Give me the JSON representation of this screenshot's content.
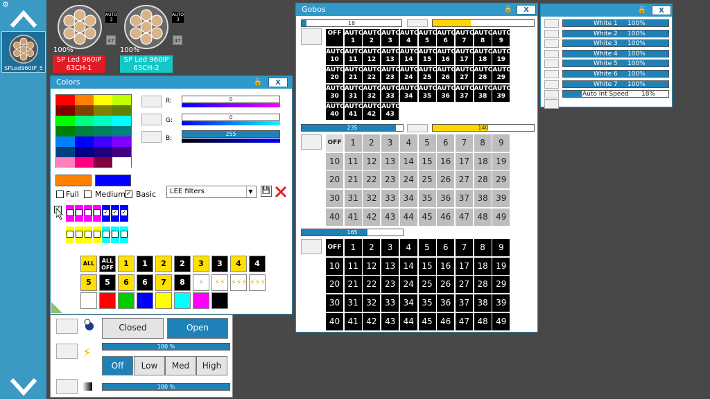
{
  "sidebar": {
    "selected_fixture_label": "SPLed960IP_5"
  },
  "fixtures": [
    {
      "percent": "100%",
      "auto_line1": "AUTO",
      "auto_line2": "3",
      "channel": "47",
      "name": "SP Led 960IP",
      "mode": "63CH-1",
      "color": "#e01b24"
    },
    {
      "percent": "100%",
      "auto_line1": "AUTO",
      "auto_line2": "3",
      "channel": "47",
      "name": "SP Led 960IP",
      "mode": "63CH-2",
      "color": "#16c7c7"
    }
  ],
  "colors_window": {
    "title": "Colors",
    "palette": [
      [
        "#ff0000",
        "#ff8000",
        "#ffff00",
        "#c0ff00"
      ],
      [
        "#800000",
        "#804000",
        "#808000",
        "#608000"
      ],
      [
        "#00ff00",
        "#00ff80",
        "#00ffc0",
        "#00ffff"
      ],
      [
        "#008000",
        "#008040",
        "#008060",
        "#008080"
      ],
      [
        "#0080ff",
        "#0000ff",
        "#4000ff",
        "#8000ff"
      ],
      [
        "#004080",
        "#000080",
        "#200080",
        "#400080"
      ],
      [
        "#ff80c0",
        "#ff0080",
        "#800040",
        "#ffffff"
      ]
    ],
    "r_label": "R:",
    "r_value": "0",
    "g_label": "G:",
    "g_value": "0",
    "b_label": "B:",
    "b_value": "255",
    "swatch_current": "#ff8000",
    "swatch_target": "#0000ff",
    "opt_full": "Full",
    "opt_medium": "Medium",
    "opt_basic": "Basic",
    "filter_select": "LEE filters",
    "save_icon": "save-icon",
    "delete_icon": "close-icon",
    "grid_keys": [
      [
        {
          "t": "ALL",
          "c": "y"
        },
        {
          "t": "ALL OFF",
          "c": "k"
        },
        {
          "t": "1",
          "c": "y"
        },
        {
          "t": "1",
          "c": "k"
        },
        {
          "t": "2",
          "c": "y"
        },
        {
          "t": "2",
          "c": "k"
        },
        {
          "t": "3",
          "c": "y"
        },
        {
          "t": "3",
          "c": "k"
        },
        {
          "t": "4",
          "c": "y"
        },
        {
          "t": "4",
          "c": "k"
        }
      ],
      [
        {
          "t": "5",
          "c": "y"
        },
        {
          "t": "5",
          "c": "k"
        },
        {
          "t": "6",
          "c": "y"
        },
        {
          "t": "6",
          "c": "k"
        },
        {
          "t": "7",
          "c": "y"
        },
        {
          "t": "8",
          "c": "k"
        },
        {
          "t": "⚡",
          "c": "w"
        },
        {
          "t": "⚡⚡",
          "c": "w"
        },
        {
          "t": "⚡⚡⚡",
          "c": "w"
        },
        {
          "t": "⚡⚡⚡",
          "c": "w"
        }
      ]
    ],
    "color_keys": [
      "#ffffff",
      "#ff0000",
      "#00cc00",
      "#0000ff",
      "#ffff00",
      "#00ffff",
      "#ff00ff",
      "#000000"
    ]
  },
  "shutter_panel": {
    "closed_label": "Closed",
    "open_label": "Open",
    "dimmer_text": "100 %",
    "dimmer_fraction": 1.0,
    "strobe_off": "Off",
    "strobe_low": "Low",
    "strobe_med": "Med",
    "strobe_high": "High",
    "zoom_text": "100 %",
    "zoom_fraction": 1.0
  },
  "gobos_window": {
    "title": "Gobos",
    "slider1_value": "18",
    "slider1_fraction": 0.05,
    "slider1b_fraction": 0.38,
    "auto_off": "OFF",
    "auto_prefix": "AUTO",
    "slider2_value": "235",
    "slider2_fraction": 0.93,
    "slider2b_value": "140",
    "slider2b_fraction": 0.55,
    "gobo_off": "OFF",
    "slider3_value": "165",
    "slider3_fraction": 0.65,
    "gobo2_off": "OFF"
  },
  "whites_window": {
    "rows": [
      {
        "name": "White 1",
        "value": "100%"
      },
      {
        "name": "White 2",
        "value": "100%"
      },
      {
        "name": "White 3",
        "value": "100%"
      },
      {
        "name": "White 4",
        "value": "100%"
      },
      {
        "name": "White 5",
        "value": "100%"
      },
      {
        "name": "White 6",
        "value": "100%"
      },
      {
        "name": "White 7",
        "value": "100%"
      }
    ],
    "speed_label": "Auto Int Speed",
    "speed_value": "18%",
    "speed_fraction": 0.18
  },
  "icons": {
    "settings": "gear-icon",
    "up": "chevron-up-icon",
    "down": "chevron-down-icon",
    "lock": "lock-icon",
    "close": "close-icon"
  }
}
